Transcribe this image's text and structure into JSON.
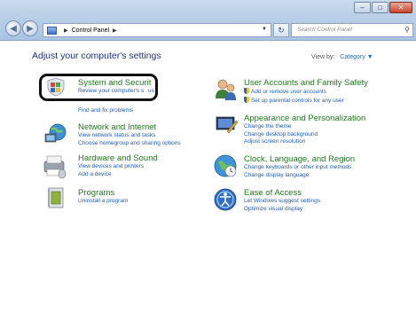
{
  "window": {
    "minimize_icon": "minimize-icon",
    "maximize_icon": "maximize-icon",
    "close_icon": "close-icon"
  },
  "address": {
    "segment": "Control Panel",
    "search_placeholder": "Search Control Panel"
  },
  "main": {
    "heading": "Adjust your computer's settings",
    "view_by_label": "View by:",
    "view_by_value": "Category"
  },
  "categories": {
    "system_security": {
      "title": "System and Securit",
      "links": [
        "Review your computer's s",
        "us",
        "Find and fix problems"
      ]
    },
    "network": {
      "title": "Network and Internet",
      "links": [
        "View network status and tasks",
        "Choose homegroup and sharing options"
      ]
    },
    "hardware": {
      "title": "Hardware and Sound",
      "links": [
        "View devices and printers",
        "Add a device"
      ]
    },
    "programs": {
      "title": "Programs",
      "links": [
        "Uninstall a program"
      ]
    },
    "user_accounts": {
      "title": "User Accounts and Family Safety",
      "links": [
        "Add or remove user accounts",
        "Set up parental controls for any user"
      ]
    },
    "appearance": {
      "title": "Appearance and Personalization",
      "links": [
        "Change the theme",
        "Change desktop background",
        "Adjust screen resolution"
      ]
    },
    "clock": {
      "title": "Clock, Language, and Region",
      "links": [
        "Change keyboards or other input methods",
        "Change display language"
      ]
    },
    "ease": {
      "title": "Ease of Access",
      "links": [
        "Let Windows suggest settings",
        "Optimize visual display"
      ]
    }
  },
  "colors": {
    "category_title": "#1e7a1e",
    "link": "#1e5fb8",
    "heading": "#1e3287"
  }
}
